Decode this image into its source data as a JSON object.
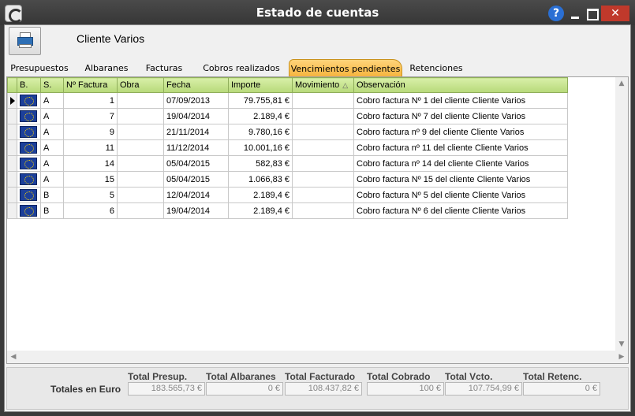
{
  "window": {
    "title": "Estado de cuentas",
    "help_label": "?",
    "close_label": "✕"
  },
  "header": {
    "client_name": "Cliente Varios"
  },
  "tabs": [
    {
      "label": "Presupuestos"
    },
    {
      "label": "Albaranes"
    },
    {
      "label": "Facturas"
    },
    {
      "label": "Cobros realizados"
    },
    {
      "label": "Vencimientos pendientes",
      "active": true
    },
    {
      "label": "Retenciones"
    }
  ],
  "grid": {
    "columns": [
      "B.",
      "S.",
      "Nº Factura",
      "Obra",
      "Fecha",
      "Importe",
      "Movimiento",
      "Observación"
    ],
    "sort_indicator": "△",
    "rows": [
      {
        "serie": "A",
        "factura": "1",
        "obra": "",
        "fecha": "07/09/2013",
        "importe": "79.755,81 €",
        "movimiento": "",
        "obs": "Cobro factura Nº 1 del cliente Cliente Varios"
      },
      {
        "serie": "A",
        "factura": "7",
        "obra": "",
        "fecha": "19/04/2014",
        "importe": "2.189,4 €",
        "movimiento": "",
        "obs": "Cobro factura Nº 7 del cliente Cliente Varios"
      },
      {
        "serie": "A",
        "factura": "9",
        "obra": "",
        "fecha": "21/11/2014",
        "importe": "9.780,16 €",
        "movimiento": "",
        "obs": "Cobro factura nº 9 del cliente Cliente Varios"
      },
      {
        "serie": "A",
        "factura": "11",
        "obra": "",
        "fecha": "11/12/2014",
        "importe": "10.001,16 €",
        "movimiento": "",
        "obs": "Cobro factura nº 11 del cliente Cliente Varios"
      },
      {
        "serie": "A",
        "factura": "14",
        "obra": "",
        "fecha": "05/04/2015",
        "importe": "582,83 €",
        "movimiento": "",
        "obs": "Cobro factura nº 14 del cliente Cliente Varios"
      },
      {
        "serie": "A",
        "factura": "15",
        "obra": "",
        "fecha": "05/04/2015",
        "importe": "1.066,83 €",
        "movimiento": "",
        "obs": "Cobro factura Nº 15 del cliente Cliente Varios"
      },
      {
        "serie": "B",
        "factura": "5",
        "obra": "",
        "fecha": "12/04/2014",
        "importe": "2.189,4 €",
        "movimiento": "",
        "obs": "Cobro factura Nº 5 del cliente Cliente Varios"
      },
      {
        "serie": "B",
        "factura": "6",
        "obra": "",
        "fecha": "19/04/2014",
        "importe": "2.189,4 €",
        "movimiento": "",
        "obs": "Cobro factura Nº 6 del cliente Cliente Varios"
      }
    ]
  },
  "totals": {
    "row_label": "Totales en Euro",
    "items": [
      {
        "label": "Total Presup.",
        "value": "183.565,73 €"
      },
      {
        "label": "Total Albaranes",
        "value": "0 €"
      },
      {
        "label": "Total Facturado",
        "value": "108.437,82 €"
      },
      {
        "label": "Total Cobrado",
        "value": "100 €"
      },
      {
        "label": "Total Vcto.",
        "value": "107.754,99 €"
      },
      {
        "label": "Total Retenc.",
        "value": "0 €"
      }
    ]
  },
  "colors": {
    "accent_tab": "#f5b33c",
    "grid_header": "#b7d97a",
    "close_button": "#c0392b",
    "help_button": "#2a6fd4",
    "flag": "#1c3f9a"
  },
  "icons": [
    "app-icon",
    "printer-icon",
    "help-icon",
    "minimize-icon",
    "maximize-icon",
    "close-icon",
    "eu-flag-icon",
    "row-indicator-icon",
    "sort-icon"
  ]
}
